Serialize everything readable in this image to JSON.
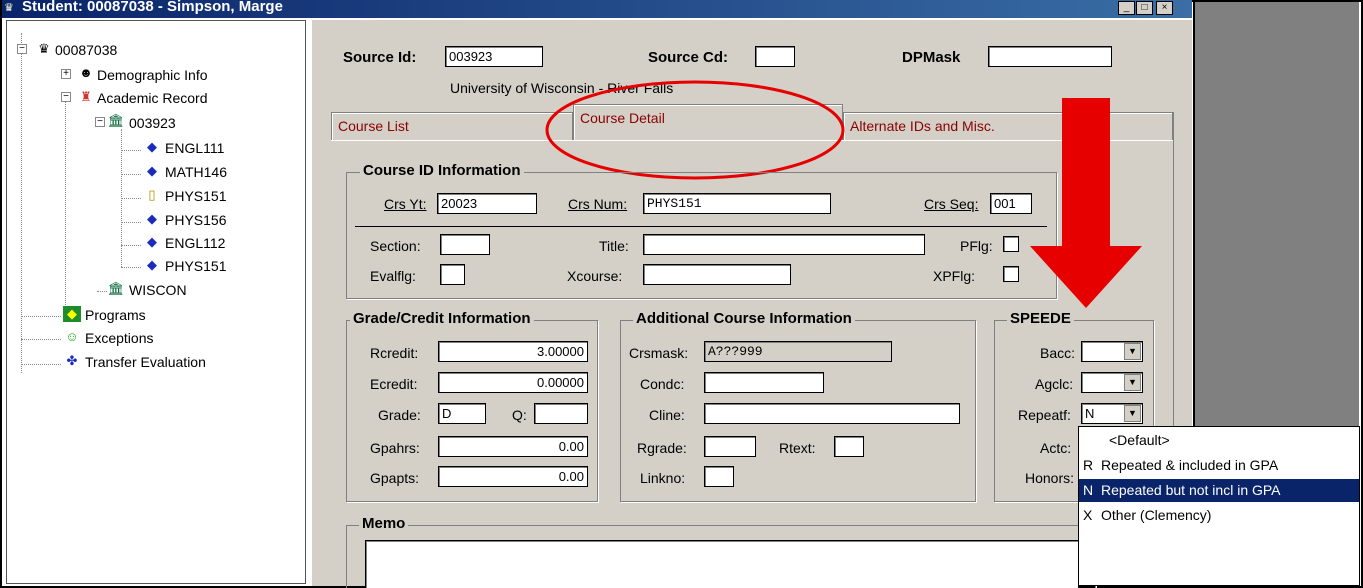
{
  "window": {
    "title": "Student: 00087038 - Simpson, Marge",
    "title_icon": "student-icon",
    "controls": [
      "_",
      "□",
      "×"
    ]
  },
  "tree": {
    "root": "00087038",
    "demographic": "Demographic Info",
    "academic": "Academic Record",
    "source": "003923",
    "courses": [
      "ENGL111",
      "MATH146",
      "PHYS151",
      "PHYS156",
      "ENGL112",
      "PHYS151"
    ],
    "wiscon": "WISCON",
    "programs": "Programs",
    "exceptions": "Exceptions",
    "transfer": "Transfer Evaluation"
  },
  "header": {
    "source_id_label": "Source Id:",
    "source_id": "003923",
    "source_cd_label": "Source Cd:",
    "source_cd": "",
    "dpmask_label": "DPMask",
    "dpmask": "",
    "institution": "University of Wisconsin - River Falls"
  },
  "tabs": [
    "Course List",
    "Course Detail",
    "Alternate IDs and Misc."
  ],
  "course_id": {
    "title": "Course ID Information",
    "crs_yt_label": "Crs Yt:",
    "crs_yt": "20023",
    "crs_num_label": "Crs Num:",
    "crs_num": "PHYS151",
    "crs_seq_label": "Crs Seq:",
    "crs_seq": "001",
    "section_label": "Section:",
    "title_label": "Title:",
    "pflg_label": "PFlg:",
    "evalflg_label": "Evalflg:",
    "xcourse_label": "Xcourse:",
    "xpflg_label": "XPFlg:"
  },
  "grade": {
    "title": "Grade/Credit Information",
    "rcredit_label": "Rcredit:",
    "rcredit": "3.00000",
    "ecredit_label": "Ecredit:",
    "ecredit": "0.00000",
    "grade_label": "Grade:",
    "grade": "D",
    "q_label": "Q:",
    "gpahrs_label": "Gpahrs:",
    "gpahrs": "0.00",
    "gpapts_label": "Gpapts:",
    "gpapts": "0.00"
  },
  "additional": {
    "title": "Additional Course Information",
    "crsmask_label": "Crsmask:",
    "crsmask": "A???999",
    "condc_label": "Condc:",
    "cline_label": "Cline:",
    "rgrade_label": "Rgrade:",
    "rtext_label": "Rtext:",
    "linkno_label": "Linkno:"
  },
  "speede": {
    "title": "SPEEDE",
    "bacc_label": "Bacc:",
    "agclc_label": "Agclc:",
    "repeatf_label": "Repeatf:",
    "repeatf": "N",
    "actc_label": "Actc:",
    "honors_label": "Honors:"
  },
  "memo": {
    "title": "Memo"
  },
  "dropdown_options": [
    {
      "code": "",
      "text": "<Default>"
    },
    {
      "code": "R",
      "text": "Repeated & included in GPA"
    },
    {
      "code": "N",
      "text": "Repeated but not incl in GPA",
      "selected": true
    },
    {
      "code": "X",
      "text": "Other (Clemency)"
    }
  ],
  "colors": {
    "annotation": "#e60000",
    "tab_text": "#8b0000",
    "selection": "#0a246a"
  }
}
